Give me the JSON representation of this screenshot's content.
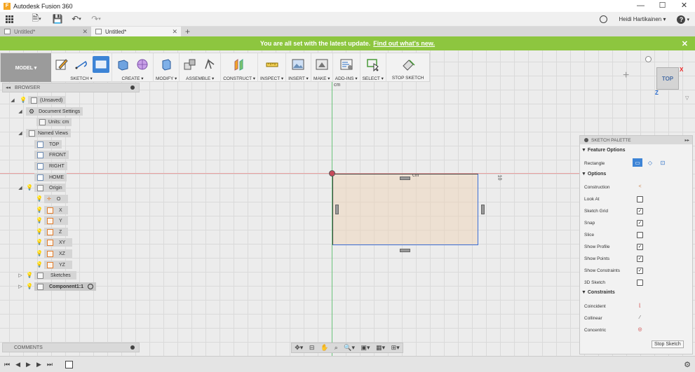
{
  "window": {
    "title": "Autodesk Fusion 360",
    "controls": [
      "—",
      "☐",
      "✕"
    ]
  },
  "quick_access": {
    "user": "Heidi Hartikainen ▾",
    "help": "?"
  },
  "tabs": [
    {
      "label": "Untitled*",
      "active": false
    },
    {
      "label": "Untitled*",
      "active": true
    }
  ],
  "banner": {
    "text": "You are all set with the latest update.",
    "link": "Find out what's new."
  },
  "toolbar": {
    "workspace": "MODEL ▾",
    "groups": [
      {
        "label": "SKETCH ▾"
      },
      {
        "label": "CREATE ▾"
      },
      {
        "label": "MODIFY ▾"
      },
      {
        "label": "ASSEMBLE ▾"
      },
      {
        "label": "CONSTRUCT ▾"
      },
      {
        "label": "INSPECT ▾"
      },
      {
        "label": "INSERT ▾"
      },
      {
        "label": "MAKE ▾"
      },
      {
        "label": "ADD-INS ▾"
      },
      {
        "label": "SELECT ▾"
      },
      {
        "label": "STOP SKETCH"
      }
    ]
  },
  "browser": {
    "title": "BROWSER",
    "nodes": {
      "root": "(Unsaved)",
      "doc_settings": "Document Settings",
      "units": "Units: cm",
      "named_views": "Named Views",
      "top": "TOP",
      "front": "FRONT",
      "right": "RIGHT",
      "home": "HOME",
      "origin": "Origin",
      "o": "O",
      "x": "X",
      "y": "Y",
      "z": "Z",
      "xy": "XY",
      "xz": "XZ",
      "yz": "YZ",
      "sketches": "Sketches",
      "component": "Component1:1"
    }
  },
  "comments": {
    "title": "COMMENTS"
  },
  "canvas": {
    "dim_top": "cm",
    "dim_rect": "cm",
    "dim_right": "10",
    "viewcube": {
      "face": "TOP",
      "x": "X",
      "z": "Z"
    }
  },
  "palette": {
    "title": "SKETCH PALETTE",
    "feature_options": "▼ Feature Options",
    "rectangle": "Rectangle",
    "options": "▼ Options",
    "constraints": "▼ Constraints",
    "rows": {
      "construction": "Construction",
      "look_at": "Look At",
      "sketch_grid": "Sketch Grid",
      "snap": "Snap",
      "slice": "Slice",
      "show_profile": "Show Profile",
      "show_points": "Show Points",
      "show_constraints": "Show Constraints",
      "sketch_3d": "3D Sketch",
      "coincident": "Coincident",
      "collinear": "Collinear",
      "concentric": "Concentric"
    },
    "checked": {
      "sketch_grid": "✓",
      "snap": "✓",
      "slice": "",
      "show_profile": "✓",
      "show_points": "✓",
      "show_constraints": "✓",
      "sketch_3d": ""
    },
    "stop_button": "Stop Sketch"
  },
  "colors": {
    "banner": "#8dc63f",
    "accent": "#3d84d6",
    "x_axis": "#e9a0a0",
    "y_axis": "#6bc47b"
  }
}
